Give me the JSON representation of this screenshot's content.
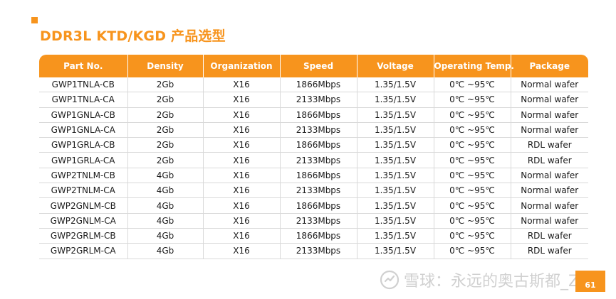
{
  "title": "DDR3L KTD/KGD 产品选型",
  "table": {
    "headers": [
      "Part No.",
      "Density",
      "Organization",
      "Speed",
      "Voltage",
      "Operating Temp.",
      "Package"
    ],
    "rows": [
      [
        "GWP1TNLA-CB",
        "2Gb",
        "X16",
        "1866Mbps",
        "1.35/1.5V",
        "0℃ ~95℃",
        "Normal wafer"
      ],
      [
        "GWP1TNLA-CA",
        "2Gb",
        "X16",
        "2133Mbps",
        "1.35/1.5V",
        "0℃ ~95℃",
        "Normal wafer"
      ],
      [
        "GWP1GNLA-CB",
        "2Gb",
        "X16",
        "1866Mbps",
        "1.35/1.5V",
        "0℃ ~95℃",
        "Normal wafer"
      ],
      [
        "GWP1GNLA-CA",
        "2Gb",
        "X16",
        "2133Mbps",
        "1.35/1.5V",
        "0℃ ~95℃",
        "Normal wafer"
      ],
      [
        "GWP1GRLA-CB",
        "2Gb",
        "X16",
        "1866Mbps",
        "1.35/1.5V",
        "0℃ ~95℃",
        "RDL wafer"
      ],
      [
        "GWP1GRLA-CA",
        "2Gb",
        "X16",
        "2133Mbps",
        "1.35/1.5V",
        "0℃ ~95℃",
        "RDL wafer"
      ],
      [
        "GWP2TNLM-CB",
        "4Gb",
        "X16",
        "1866Mbps",
        "1.35/1.5V",
        "0℃ ~95℃",
        "Normal wafer"
      ],
      [
        "GWP2TNLM-CA",
        "4Gb",
        "X16",
        "2133Mbps",
        "1.35/1.5V",
        "0℃ ~95℃",
        "Normal wafer"
      ],
      [
        "GWP2GNLM-CB",
        "4Gb",
        "X16",
        "1866Mbps",
        "1.35/1.5V",
        "0℃ ~95℃",
        "Normal wafer"
      ],
      [
        "GWP2GNLM-CA",
        "4Gb",
        "X16",
        "2133Mbps",
        "1.35/1.5V",
        "0℃ ~95℃",
        "Normal wafer"
      ],
      [
        "GWP2GRLM-CB",
        "4Gb",
        "X16",
        "1866Mbps",
        "1.35/1.5V",
        "0℃ ~95℃",
        "RDL wafer"
      ],
      [
        "GWP2GRLM-CA",
        "4Gb",
        "X16",
        "2133Mbps",
        "1.35/1.5V",
        "0℃ ~95℃",
        "RDL wafer"
      ]
    ]
  },
  "watermark": {
    "text": "雪球：永远的奥古斯都_Z",
    "icon": "snowball-logo-icon"
  },
  "page_number": "61",
  "colors": {
    "accent": "#f7941d",
    "header_text": "#ffffff",
    "row_divider": "#d9d9d9",
    "watermark": "#d0d0d0"
  }
}
